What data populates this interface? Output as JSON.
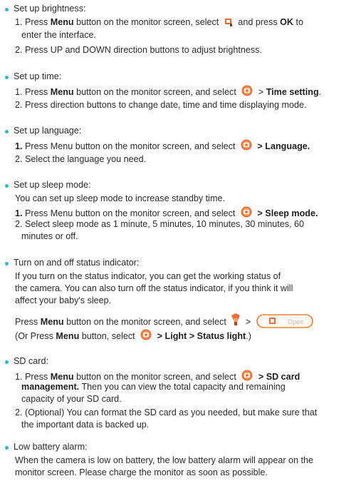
{
  "sections": [
    {
      "heading": "Set up brightness:",
      "lines": [
        {
          "pre": "1. Press ",
          "bold1": "Menu",
          "mid": " button on the monitor screen, select ",
          "icon": "brightness-icon",
          "post": " and press ",
          "bold2": "OK",
          "tail": " to"
        },
        {
          "text": "enter the interface."
        },
        {
          "text": "2. Press UP and DOWN direction buttons to adjust brightness."
        }
      ]
    },
    {
      "heading": "Set up time:",
      "lines": [
        {
          "pre": "1. Press ",
          "bold1": "Menu",
          "mid": " button on the monitor screen, and select ",
          "icon": "settings-gear-icon",
          "post": " > ",
          "bold2": "Time setting",
          "tail": "."
        },
        {
          "text": "2. Press direction buttons to change date, time and time displaying mode."
        }
      ]
    },
    {
      "heading": "Set up language:",
      "lines": [
        {
          "pre": "1.",
          "bold1": "",
          "mid": " Press Menu button on the monitor screen, and select ",
          "icon": "settings-gear-icon",
          "post": " > ",
          "bold2": "Language.",
          "tail": ""
        },
        {
          "text": "2. Select the language you need."
        }
      ]
    },
    {
      "heading": "Set up sleep mode:",
      "lines": [
        {
          "text": "You can set up sleep mode to increase standby time."
        },
        {
          "pre": "1.",
          "bold1": "",
          "mid": " Press Menu button on the monitor screen, and select ",
          "icon": "settings-gear-icon",
          "post": " > ",
          "bold2": "Sleep mode.",
          "tail": ""
        },
        {
          "text": "2. Select sleep mode as 1 minute, 5 minutes, 10 minutes, 30 minutes, 60"
        },
        {
          "text": "minutes or off."
        }
      ]
    },
    {
      "heading": "Turn on and off status indicator:",
      "lines": [
        {
          "text": "If you turn on the status indicator, you can get the working status of"
        },
        {
          "text": "the camera. You can also turn off the status indicator, if you think it will"
        },
        {
          "text": "affect your baby's sleep."
        },
        {
          "pre": "Press ",
          "bold1": "Menu",
          "mid": " button on the monitor screen, and select ",
          "icon": "light-icon",
          "post": " > ",
          "toggle_label": "Open"
        },
        {
          "pre": "(Or Press ",
          "bold1": "Menu",
          "mid": " button, select ",
          "icon": "settings-gear-icon",
          "post": " > ",
          "bold2": "Light > Status light",
          "tail": ".)"
        }
      ]
    },
    {
      "heading": "SD card:",
      "lines": [
        {
          "pre": "1. Press ",
          "bold1": "Menu",
          "mid": " button on the monitor screen, and select ",
          "icon": "settings-gear-icon",
          "post": " > ",
          "bold2": "SD card",
          "tail": ""
        },
        {
          "bold_only": "management.",
          "text_after": " Then you can view the total capacity and remaining"
        },
        {
          "text": "capacity of your SD card."
        },
        {
          "text": "2. (Optional) You can format the SD card as you needed, but make sure that"
        },
        {
          "text": "the important data is backed up."
        }
      ]
    },
    {
      "heading": "Low battery alarm:",
      "lines": [
        {
          "text": "When the camera is low on battery, the low battery alarm will appear on the"
        },
        {
          "text": "monitor screen. Please charge the monitor as soon as possible."
        }
      ]
    }
  ],
  "colors": {
    "bullet": "#33b5c9",
    "gear": "#e8552f",
    "text": "#2b2b2b"
  }
}
